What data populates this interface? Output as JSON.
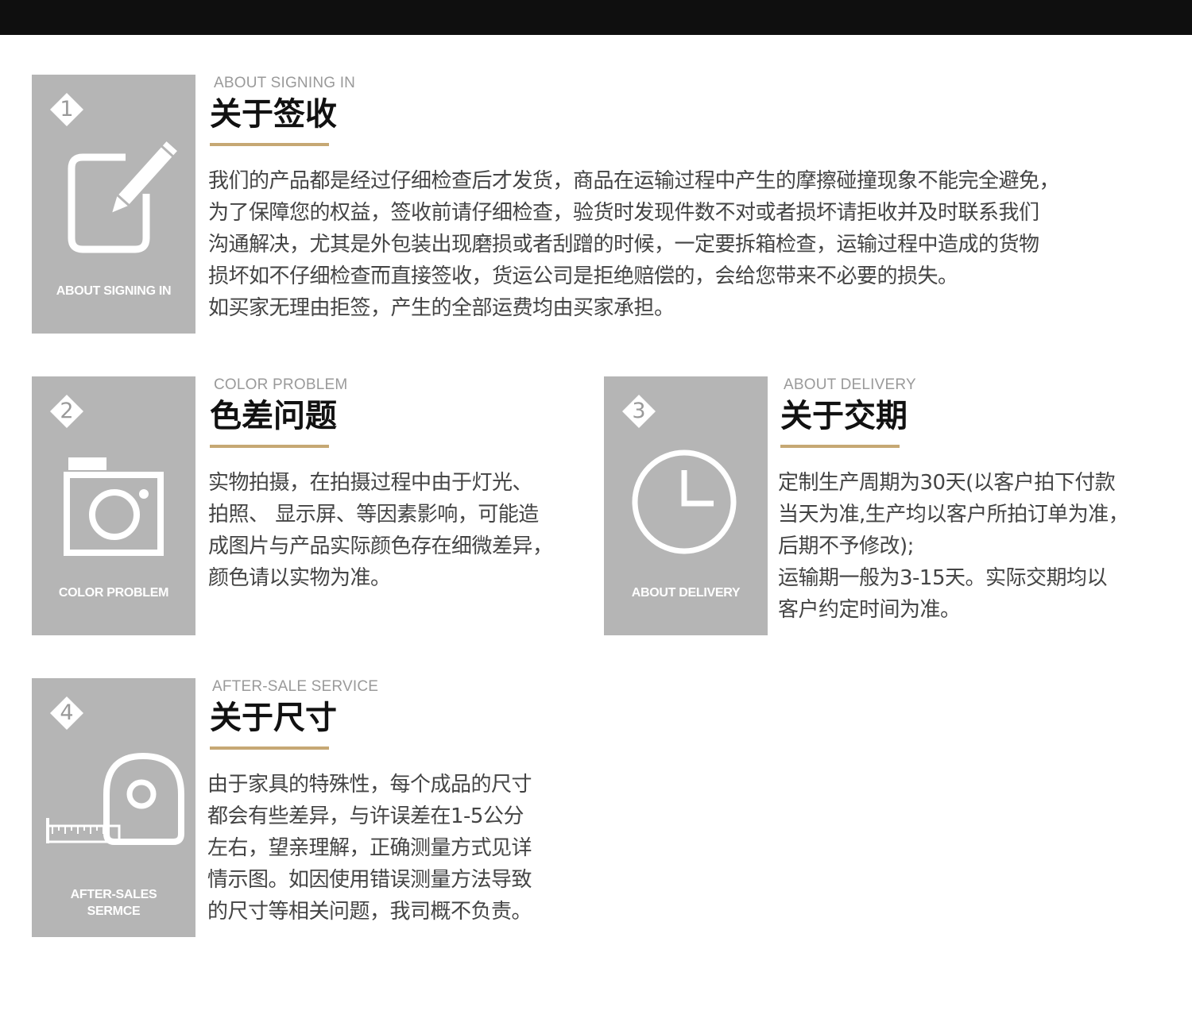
{
  "sections": [
    {
      "number": "1",
      "tile_caption": [
        "ABOUT SIGNING IN"
      ],
      "en_title": "ABOUT SIGNING IN",
      "cn_title": "关于签收",
      "lines": [
        "我们的产品都是经过仔细检查后才发货，商品在运输过程中产生的摩擦碰撞现象不能完全避免，",
        "为了保障您的权益，签收前请仔细检查，验货时发现件数不对或者损坏请拒收并及时联系我们",
        "沟通解决，尤其是外包装出现磨损或者刮蹭的时候，一定要拆箱检查，运输过程中造成的货物",
        "损坏如不仔细检查而直接签收，货运公司是拒绝赔偿的，会给您带来不必要的损失。",
        "如买家无理由拒签，产生的全部运费均由买家承担。"
      ],
      "icon": "edit-icon"
    },
    {
      "number": "2",
      "tile_caption": [
        "COLOR PROBLEM"
      ],
      "en_title": "COLOR PROBLEM",
      "cn_title": "色差问题",
      "lines": [
        "实物拍摄，在拍摄过程中由于灯光、",
        "拍照、 显示屏、等因素影响，可能造",
        "成图片与产品实际颜色存在细微差异，",
        "颜色请以实物为准。"
      ],
      "icon": "camera-icon"
    },
    {
      "number": "3",
      "tile_caption": [
        "ABOUT DELIVERY"
      ],
      "en_title": "ABOUT DELIVERY",
      "cn_title": "关于交期",
      "lines": [
        "定制生产周期为30天(以客户拍下付款",
        "当天为准,生产均以客户所拍订单为准，",
        "后期不予修改);",
        "运输期一般为3-15天。实际交期均以",
        "客户约定时间为准。"
      ],
      "icon": "clock-icon"
    },
    {
      "number": "4",
      "tile_caption": [
        "AFTER-SALES",
        "SERMCE"
      ],
      "en_title": "AFTER-SALE SERVICE",
      "cn_title": "关于尺寸",
      "lines": [
        "由于家具的特殊性，每个成品的尺寸",
        "都会有些差异，与许误差在1-5公分",
        "左右，望亲理解，正确测量方式见详",
        "情示图。如因使用错误测量方法导致",
        "的尺寸等相关问题，我司概不负责。"
      ],
      "icon": "tape-measure-icon"
    }
  ],
  "colors": {
    "tile": "#b5b5b5",
    "accent_line": "#c6a874",
    "top_bar": "#0f0f0f"
  }
}
